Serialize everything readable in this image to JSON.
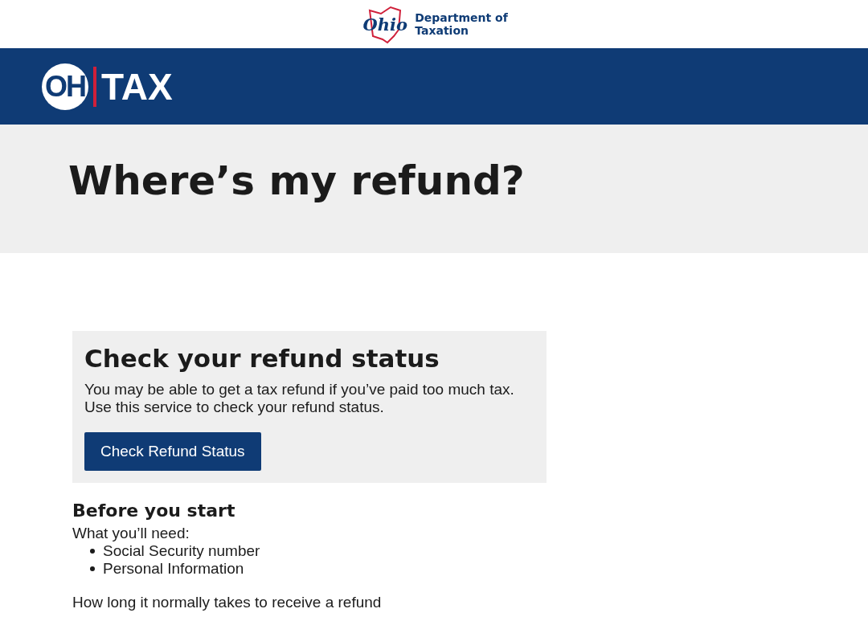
{
  "agency_logo": {
    "mark": "Ohio",
    "name_line_1": "Department of",
    "name_line_2": "Taxation"
  },
  "brand_logo": {
    "left": "OH",
    "right": "TAX"
  },
  "hero": {
    "title": "Where’s my refund?"
  },
  "card": {
    "title": "Check your refund status",
    "text_1": "You may be able to get a tax refund if you’ve paid too much tax.",
    "text_2": "Use this service to check your refund status.",
    "button": "Check Refund Status"
  },
  "before": {
    "title": "Before you start",
    "intro": "What you’ll need:",
    "items": [
      "Social Security number",
      "Personal Information"
    ]
  },
  "footer_text": "How long it normally takes to receive a refund"
}
